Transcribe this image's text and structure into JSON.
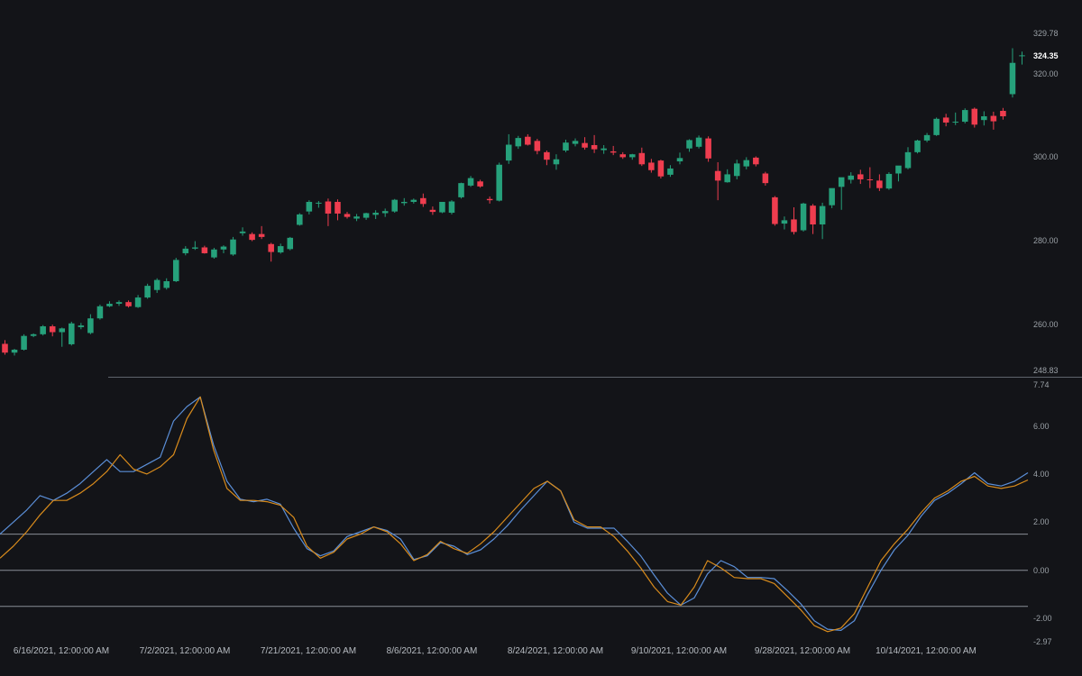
{
  "chart_data": [
    {
      "type": "candlestick",
      "price_axis": {
        "ylim": [
          248.83,
          329.78
        ],
        "top_label": "329.78",
        "bottom_label": "248.83",
        "ticks": [
          "320.00",
          "300.00",
          "280.00",
          "260.00"
        ],
        "last_price_label": "324.35"
      },
      "colors": {
        "up": "#26a17b",
        "down": "#ef3d4f",
        "background": "#131418"
      },
      "candles": [
        [
          255.2,
          256.1,
          252.6,
          253.1
        ],
        [
          253.1,
          254.0,
          252.4,
          253.8
        ],
        [
          253.8,
          257.5,
          253.6,
          257.1
        ],
        [
          257.1,
          257.7,
          256.8,
          257.5
        ],
        [
          257.5,
          259.7,
          257.2,
          259.4
        ],
        [
          259.4,
          259.8,
          257.0,
          258.0
        ],
        [
          258.0,
          259.1,
          254.5,
          258.9
        ],
        [
          255.1,
          260.5,
          254.8,
          260.1
        ],
        [
          259.2,
          260.2,
          258.7,
          259.6
        ],
        [
          257.8,
          262.3,
          257.5,
          261.3
        ],
        [
          261.3,
          264.6,
          261.0,
          264.2
        ],
        [
          264.2,
          265.4,
          264.0,
          264.8
        ],
        [
          264.8,
          265.6,
          264.3,
          265.2
        ],
        [
          265.2,
          265.6,
          263.9,
          264.2
        ],
        [
          264.0,
          266.9,
          263.8,
          266.3
        ],
        [
          266.3,
          269.6,
          266.0,
          269.1
        ],
        [
          268.1,
          270.9,
          267.4,
          270.5
        ],
        [
          268.6,
          270.9,
          268.2,
          270.2
        ],
        [
          270.2,
          275.8,
          270.0,
          275.3
        ],
        [
          276.9,
          278.6,
          276.4,
          278.0
        ],
        [
          278.0,
          279.8,
          277.7,
          278.3
        ],
        [
          278.3,
          278.7,
          276.8,
          276.9
        ],
        [
          275.9,
          278.2,
          275.6,
          277.8
        ],
        [
          277.8,
          278.8,
          276.9,
          278.5
        ],
        [
          276.6,
          280.8,
          276.3,
          280.2
        ],
        [
          281.7,
          283.1,
          281.1,
          282.1
        ],
        [
          281.5,
          281.9,
          279.8,
          280.1
        ],
        [
          281.5,
          283.4,
          280.3,
          280.8
        ],
        [
          279.1,
          279.4,
          274.9,
          277.2
        ],
        [
          277.1,
          279.2,
          276.8,
          278.6
        ],
        [
          277.9,
          280.8,
          277.6,
          280.6
        ],
        [
          283.7,
          286.5,
          283.5,
          286.2
        ],
        [
          286.9,
          289.6,
          286.2,
          289.2
        ],
        [
          288.8,
          289.4,
          287.8,
          289.0
        ],
        [
          289.3,
          290.0,
          283.4,
          286.4
        ],
        [
          289.2,
          289.8,
          284.8,
          286.4
        ],
        [
          286.3,
          286.8,
          285.2,
          285.6
        ],
        [
          285.2,
          286.3,
          284.6,
          285.7
        ],
        [
          285.4,
          286.6,
          284.9,
          286.5
        ],
        [
          286.1,
          287.2,
          285.1,
          286.6
        ],
        [
          286.5,
          287.6,
          285.6,
          287.0
        ],
        [
          286.9,
          289.9,
          286.6,
          289.7
        ],
        [
          288.9,
          290.1,
          288.3,
          289.2
        ],
        [
          289.2,
          290.0,
          288.8,
          289.7
        ],
        [
          290.1,
          291.2,
          288.0,
          288.7
        ],
        [
          287.3,
          288.1,
          286.1,
          286.8
        ],
        [
          286.7,
          289.2,
          286.5,
          289.2
        ],
        [
          286.6,
          289.6,
          286.2,
          289.3
        ],
        [
          290.3,
          293.8,
          290.0,
          293.7
        ],
        [
          293.1,
          295.4,
          292.8,
          294.9
        ],
        [
          294.1,
          294.5,
          292.6,
          292.9
        ],
        [
          289.9,
          290.5,
          288.8,
          289.6
        ],
        [
          289.5,
          298.6,
          289.3,
          298.1
        ],
        [
          299.1,
          305.4,
          298.3,
          302.9
        ],
        [
          302.5,
          305.0,
          301.9,
          304.5
        ],
        [
          304.8,
          305.4,
          302.7,
          302.9
        ],
        [
          303.8,
          304.3,
          300.6,
          301.4
        ],
        [
          301.1,
          301.5,
          298.0,
          299.3
        ],
        [
          298.2,
          300.6,
          296.9,
          299.4
        ],
        [
          301.5,
          304.1,
          301.1,
          303.4
        ],
        [
          303.1,
          304.4,
          302.5,
          303.8
        ],
        [
          303.3,
          304.7,
          301.7,
          302.2
        ],
        [
          302.8,
          305.2,
          300.9,
          301.8
        ],
        [
          301.6,
          302.8,
          300.7,
          302.0
        ],
        [
          301.3,
          302.6,
          300.4,
          301.0
        ],
        [
          300.6,
          301.1,
          299.5,
          299.9
        ],
        [
          299.9,
          300.7,
          299.3,
          300.6
        ],
        [
          300.9,
          302.2,
          297.8,
          298.2
        ],
        [
          298.6,
          299.5,
          296.2,
          296.8
        ],
        [
          299.1,
          299.3,
          294.8,
          295.3
        ],
        [
          295.7,
          298.0,
          295.2,
          297.2
        ],
        [
          298.9,
          301.0,
          298.2,
          299.7
        ],
        [
          302.0,
          304.2,
          301.2,
          304.0
        ],
        [
          302.4,
          305.1,
          302.0,
          304.6
        ],
        [
          304.4,
          304.9,
          298.8,
          299.6
        ],
        [
          296.6,
          298.7,
          289.6,
          294.3
        ],
        [
          293.9,
          297.0,
          293.8,
          295.8
        ],
        [
          295.4,
          299.3,
          294.6,
          298.4
        ],
        [
          297.7,
          299.9,
          297.0,
          299.2
        ],
        [
          299.8,
          300.1,
          297.7,
          298.2
        ],
        [
          296.0,
          296.4,
          293.1,
          293.7
        ],
        [
          290.3,
          290.6,
          283.5,
          283.9
        ],
        [
          284.0,
          285.7,
          282.6,
          284.8
        ],
        [
          285.0,
          287.9,
          281.4,
          282.0
        ],
        [
          282.4,
          289.0,
          282.1,
          288.8
        ],
        [
          288.3,
          288.7,
          281.5,
          283.8
        ],
        [
          283.8,
          289.0,
          280.3,
          288.2
        ],
        [
          288.4,
          290.3,
          287.7,
          292.5
        ],
        [
          292.8,
          292.9,
          287.3,
          295.1
        ],
        [
          294.5,
          296.3,
          293.6,
          295.5
        ],
        [
          295.8,
          296.9,
          293.5,
          294.6
        ],
        [
          294.6,
          297.5,
          292.5,
          294.4
        ],
        [
          294.3,
          295.8,
          291.8,
          292.5
        ],
        [
          292.4,
          296.3,
          292.1,
          295.9
        ],
        [
          296.0,
          297.6,
          294.1,
          297.9
        ],
        [
          297.3,
          302.3,
          297.0,
          301.1
        ],
        [
          301.1,
          304.1,
          300.8,
          303.9
        ],
        [
          303.9,
          305.7,
          303.5,
          305.2
        ],
        [
          305.2,
          309.4,
          305.0,
          309.1
        ],
        [
          309.4,
          310.3,
          307.3,
          308.2
        ],
        [
          308.2,
          310.6,
          307.6,
          308.4
        ],
        [
          308.4,
          311.6,
          308.0,
          311.2
        ],
        [
          311.5,
          311.8,
          307.0,
          307.7
        ],
        [
          308.8,
          310.9,
          307.5,
          309.7
        ],
        [
          309.8,
          310.8,
          306.5,
          308.5
        ],
        [
          311.0,
          311.7,
          308.9,
          309.7
        ],
        [
          315.0,
          326.0,
          314.2,
          322.5
        ],
        [
          324.2,
          325.2,
          322.1,
          324.3
        ]
      ]
    },
    {
      "type": "line",
      "oscillator_axis": {
        "ylim": [
          -2.97,
          7.74
        ],
        "top_label": "7.74",
        "bottom_label": "-2.97",
        "ticks": [
          "6.00",
          "4.00",
          "2.00",
          "0.00",
          "-2.00"
        ],
        "reference_levels": [
          1.5,
          0,
          -1.5
        ]
      },
      "series": [
        {
          "color": "#5b8fd8",
          "values": [
            1.5,
            2.0,
            2.5,
            3.1,
            2.9,
            3.2,
            3.6,
            4.1,
            4.6,
            4.1,
            4.1,
            4.4,
            4.7,
            6.2,
            6.8,
            7.2,
            5.2,
            3.7,
            2.95,
            2.85,
            2.95,
            2.75,
            1.75,
            0.9,
            0.6,
            0.8,
            1.4,
            1.6,
            1.8,
            1.65,
            1.3,
            0.45,
            0.6,
            1.15,
            1.0,
            0.65,
            0.85,
            1.3,
            1.85,
            2.5,
            3.1,
            3.7,
            3.3,
            2.0,
            1.75,
            1.75,
            1.75,
            1.2,
            0.6,
            -0.2,
            -0.95,
            -1.45,
            -1.15,
            -0.15,
            0.4,
            0.15,
            -0.3,
            -0.3,
            -0.35,
            -0.85,
            -1.4,
            -2.1,
            -2.45,
            -2.5,
            -2.1,
            -1.0,
            0.0,
            0.85,
            1.45,
            2.25,
            2.9,
            3.2,
            3.6,
            4.05,
            3.6,
            3.5,
            3.7,
            4.05
          ]
        },
        {
          "color": "#d88b1c",
          "values": [
            0.5,
            1.0,
            1.6,
            2.3,
            2.9,
            2.9,
            3.2,
            3.6,
            4.1,
            4.8,
            4.2,
            4.0,
            4.3,
            4.8,
            6.3,
            7.2,
            5.0,
            3.4,
            2.9,
            2.9,
            2.85,
            2.7,
            2.2,
            1.0,
            0.5,
            0.75,
            1.3,
            1.5,
            1.8,
            1.6,
            1.1,
            0.4,
            0.65,
            1.2,
            0.9,
            0.7,
            1.1,
            1.6,
            2.2,
            2.8,
            3.4,
            3.7,
            3.3,
            2.1,
            1.8,
            1.8,
            1.4,
            0.8,
            0.1,
            -0.7,
            -1.3,
            -1.45,
            -0.7,
            0.4,
            0.1,
            -0.3,
            -0.35,
            -0.35,
            -0.55,
            -1.1,
            -1.65,
            -2.3,
            -2.55,
            -2.4,
            -1.8,
            -0.7,
            0.4,
            1.1,
            1.7,
            2.4,
            3.0,
            3.3,
            3.7,
            3.9,
            3.5,
            3.4,
            3.5,
            3.75
          ]
        }
      ]
    }
  ],
  "x_axis": {
    "tick_labels": [
      "6/16/2021, 12:00:00 AM",
      "7/2/2021, 12:00:00 AM",
      "7/21/2021, 12:00:00 AM",
      "8/6/2021, 12:00:00 AM",
      "8/24/2021, 12:00:00 AM",
      "9/10/2021, 12:00:00 AM",
      "9/28/2021, 12:00:00 AM",
      "10/14/2021, 12:00:00 AM"
    ]
  }
}
